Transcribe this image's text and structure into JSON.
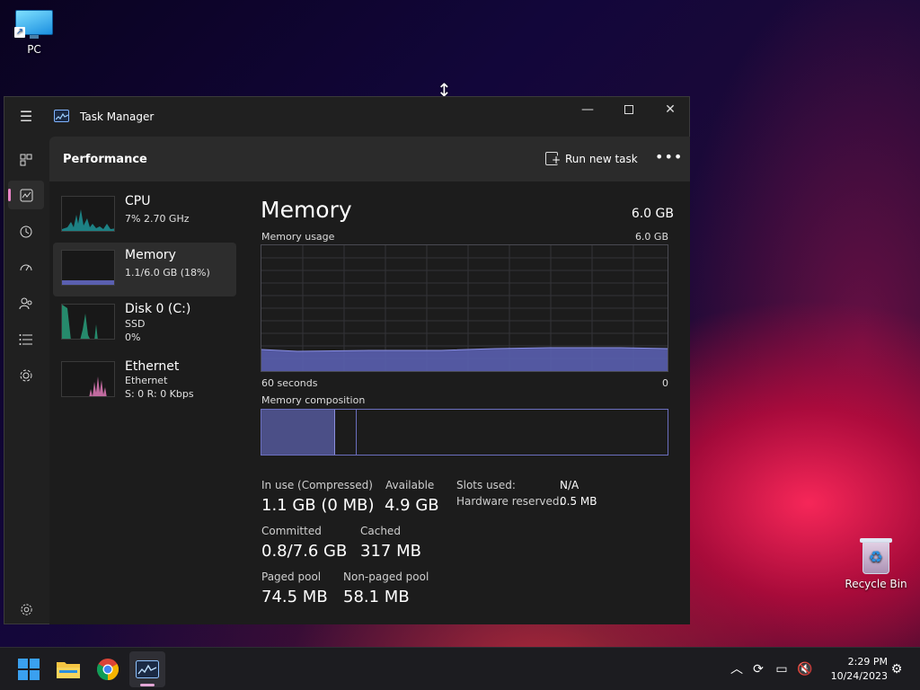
{
  "desktop": {
    "pc_label": "PC",
    "recycle_label": "Recycle Bin"
  },
  "window": {
    "title": "Task Manager",
    "minimize": "—",
    "close": "✕"
  },
  "header": {
    "page_title": "Performance",
    "run_new_task": "Run new task",
    "more": "•••"
  },
  "resources": [
    {
      "name": "CPU",
      "sub1": "7%  2.70 GHz",
      "sub2": ""
    },
    {
      "name": "Memory",
      "sub1": "1.1/6.0 GB (18%)",
      "sub2": ""
    },
    {
      "name": "Disk 0 (C:)",
      "sub1": "SSD",
      "sub2": "0%"
    },
    {
      "name": "Ethernet",
      "sub1": "Ethernet",
      "sub2": "S: 0  R: 0 Kbps"
    }
  ],
  "detail": {
    "title": "Memory",
    "total": "6.0 GB",
    "usage_label": "Memory usage",
    "usage_max": "6.0 GB",
    "time_left": "60 seconds",
    "time_right": "0",
    "composition_label": "Memory composition",
    "stats": {
      "in_use_label": "In use (Compressed)",
      "in_use_value": "1.1 GB (0 MB)",
      "available_label": "Available",
      "available_value": "4.9 GB",
      "committed_label": "Committed",
      "committed_value": "0.8/7.6 GB",
      "cached_label": "Cached",
      "cached_value": "317 MB",
      "paged_label": "Paged pool",
      "paged_value": "74.5 MB",
      "nonpaged_label": "Non-paged pool",
      "nonpaged_value": "58.1 MB",
      "slots_label": "Slots used:",
      "slots_value": "N/A",
      "hw_reserved_label": "Hardware reserved:",
      "hw_reserved_value": "0.5 MB"
    }
  },
  "taskbar": {
    "time": "2:29 PM",
    "date": "10/24/2023"
  },
  "colors": {
    "memory_fill": "#5a5fb0",
    "cpu_fill": "#1fa4a8",
    "disk_fill": "#2aa882",
    "ethernet_fill": "#e07ab8",
    "accent": "#e884c7"
  },
  "icons": [
    "hamburger-icon",
    "processes-icon",
    "performance-icon",
    "app-history-icon",
    "startup-icon",
    "users-icon",
    "details-icon",
    "services-icon",
    "settings-icon"
  ]
}
